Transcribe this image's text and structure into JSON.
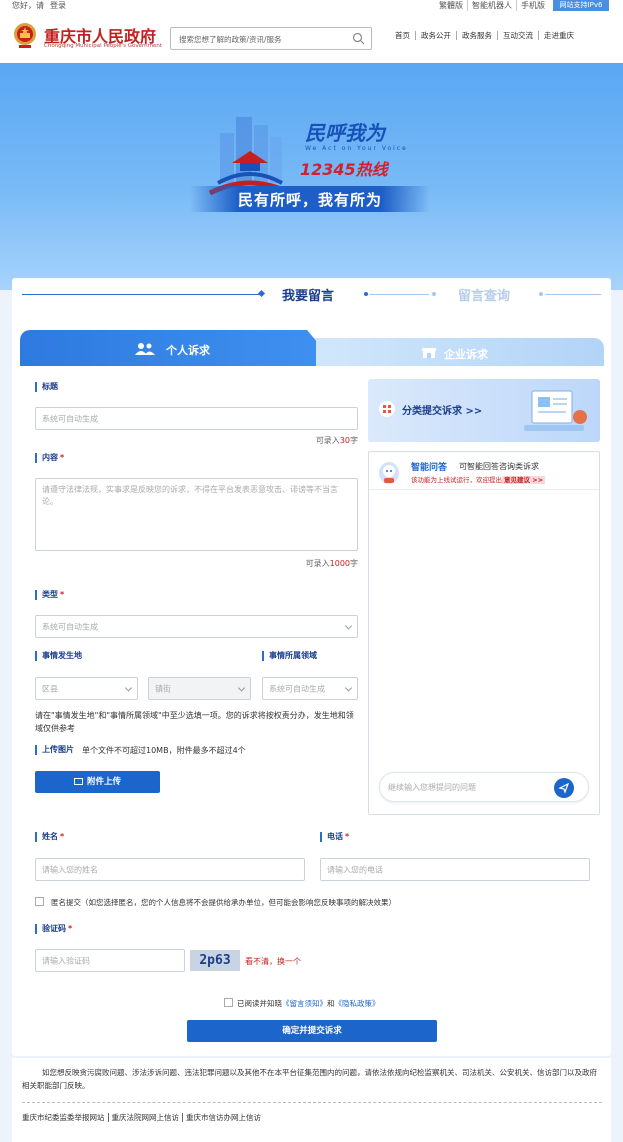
{
  "topbar": {
    "greeting": "您好，请",
    "login": "登录",
    "links": [
      "繁體版",
      "智能机器人",
      "手机版"
    ],
    "ipv6": "网站支持IPv6"
  },
  "header": {
    "site_name": "重庆市人民政府",
    "site_sub": "Chongqing Municipal People's Government",
    "search_placeholder": "搜索您想了解的政策/资讯/服务",
    "nav": [
      "首页",
      "政务公开",
      "政务服务",
      "互动交流",
      "走进重庆"
    ]
  },
  "banner": {
    "title": "民呼我为",
    "subtitle_en": "We Act on Your Voice",
    "hotline": "12345热线",
    "slogan": "民有所呼，我有所为"
  },
  "page_tabs": {
    "active": "我要留言",
    "inactive": "留言查询"
  },
  "type_tabs": {
    "personal": "个人诉求",
    "business": "企业诉求"
  },
  "form": {
    "title_label": "标题",
    "title_placeholder": "系统可自动生成",
    "title_count_prefix": "可录入",
    "title_count": "30",
    "title_count_suffix": "字",
    "content_label": "内容",
    "content_placeholder": "请遵守法律法规，实事求是反映您的诉求，不得在平台发表恶意攻击、诽谤等不当言论。",
    "content_count_prefix": "可录入",
    "content_count": "1000",
    "content_count_suffix": "字",
    "type_label": "类型",
    "type_placeholder": "系统可自动生成",
    "location_label": "事情发生地",
    "district_placeholder": "区县",
    "street_placeholder": "镇街",
    "domain_label": "事情所属领域",
    "domain_placeholder": "系统可自动生成",
    "location_note": "请在\"事情发生地\"和\"事情所属领域\"中至少选填一项。您的诉求将按权责分办，发生地和领域仅供参考",
    "upload_label": "上传图片",
    "upload_note": "单个文件不可超过10MB，附件最多不超过4个",
    "upload_button": "附件上传",
    "name_label": "姓名",
    "name_placeholder": "请输入您的姓名",
    "phone_label": "电话",
    "phone_placeholder": "请输入您的电话",
    "anon_text": "匿名提交（如您选择匿名，您的个人信息将不会提供给承办单位，但可能会影响您反映事项的解决效果）",
    "captcha_label": "验证码",
    "captcha_placeholder": "请输入验证码",
    "captcha_code": "2p63",
    "captcha_refresh": "看不清，换一个",
    "agree_prefix": "已阅读并知晓",
    "agree_link1": "《留言须知》",
    "agree_and": "和",
    "agree_link2": "《隐私政策》",
    "submit": "确定并提交诉求"
  },
  "side": {
    "classify_button": "分类提交诉求 >>",
    "chat_title": "智能问答",
    "chat_sub": "可智能回答咨询类诉求",
    "chat_tip": "该功能为上线试运行，欢迎提出",
    "chat_tip_link": "意见建议 >>",
    "chat_placeholder": "继续输入您想提问的问题"
  },
  "footer": {
    "notice": "如您想反映贪污腐败问题、涉法涉诉问题、违法犯罪问题以及其他不在本平台征集范围内的问题，请依法依规向纪检监察机关、司法机关、公安机关、信访部门以及政府相关职能部门反映。",
    "links": [
      "重庆市纪委监委举报网站",
      "重庆法院网网上信访",
      "重庆市信访办网上信访"
    ]
  },
  "colors": {
    "primary": "#1c66cb",
    "brand_red": "#c51f1f",
    "banner_blue": "#5aa7f3"
  }
}
